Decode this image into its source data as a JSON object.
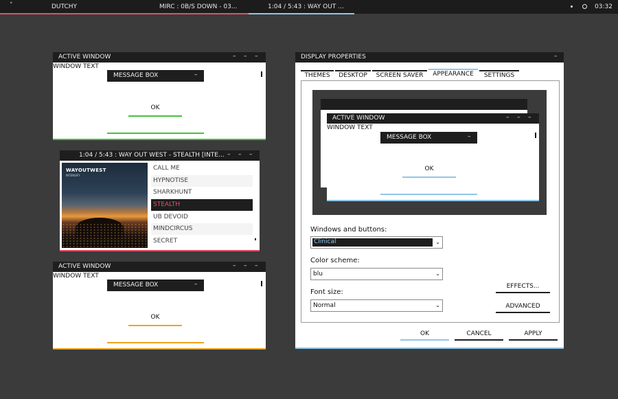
{
  "topbar": {
    "menu_glyph": "˅",
    "app_name": "DUTCHY",
    "irc_status": "MIRC : 0B/S DOWN - 03...",
    "track_status": "1:04 / 5:43 : WAY OUT ...",
    "clock": "03:32",
    "accent_pink": "#e0506a",
    "accent_blue": "#8fc7ea"
  },
  "window_green": {
    "title": "ACTIVE WINDOW",
    "controls": [
      "–",
      "–",
      "–"
    ],
    "window_text": "WINDOW TEXT",
    "message_box_title": "MESSAGE BOX",
    "message_box_control": "–",
    "ok_label": "OK",
    "accent": "#44c23a"
  },
  "player": {
    "title": "1:04 / 5:43 : WAY OUT WEST - STEALTH [INTE...",
    "controls": [
      "–",
      "–",
      "–"
    ],
    "cover_title": "WAYOUTWEST",
    "cover_subtitle": "INTENSIFY",
    "tracks": [
      "CALL ME",
      "HYPNOTISE",
      "SHARKHUNT",
      "STEALTH",
      "UB DEVOID",
      "MINDCIRCUS",
      "SECRET"
    ],
    "selected_index": 3,
    "accent": "#e0506a"
  },
  "window_orange": {
    "title": "ACTIVE WINDOW",
    "controls": [
      "–",
      "–",
      "–"
    ],
    "window_text": "WINDOW TEXT",
    "message_box_title": "MESSAGE BOX",
    "message_box_control": "–",
    "ok_label": "OK",
    "accent": "#f0a21c"
  },
  "display_properties": {
    "title": "DISPLAY PROPERTIES",
    "close_control": "–",
    "tabs": [
      "THEMES",
      "DESKTOP",
      "SCREEN SAVER",
      "APPEARANCE",
      "SETTINGS"
    ],
    "active_tab_index": 3,
    "preview": {
      "window_title": "ACTIVE WINDOW",
      "controls": [
        "–",
        "–",
        "–"
      ],
      "window_text": "WINDOW TEXT",
      "message_box_title": "MESSAGE BOX",
      "message_box_control": "–",
      "ok_label": "OK"
    },
    "windows_buttons_label": "Windows and buttons:",
    "windows_buttons_value": "Clinical",
    "color_scheme_label": "Color scheme:",
    "color_scheme_value": "blu",
    "font_size_label": "Font size:",
    "font_size_value": "Normal",
    "effects_button": "EFFECTS...",
    "advanced_button": "ADVANCED",
    "ok_button": "OK",
    "cancel_button": "CANCEL",
    "apply_button": "APPLY",
    "accent": "#8fc7ea"
  }
}
